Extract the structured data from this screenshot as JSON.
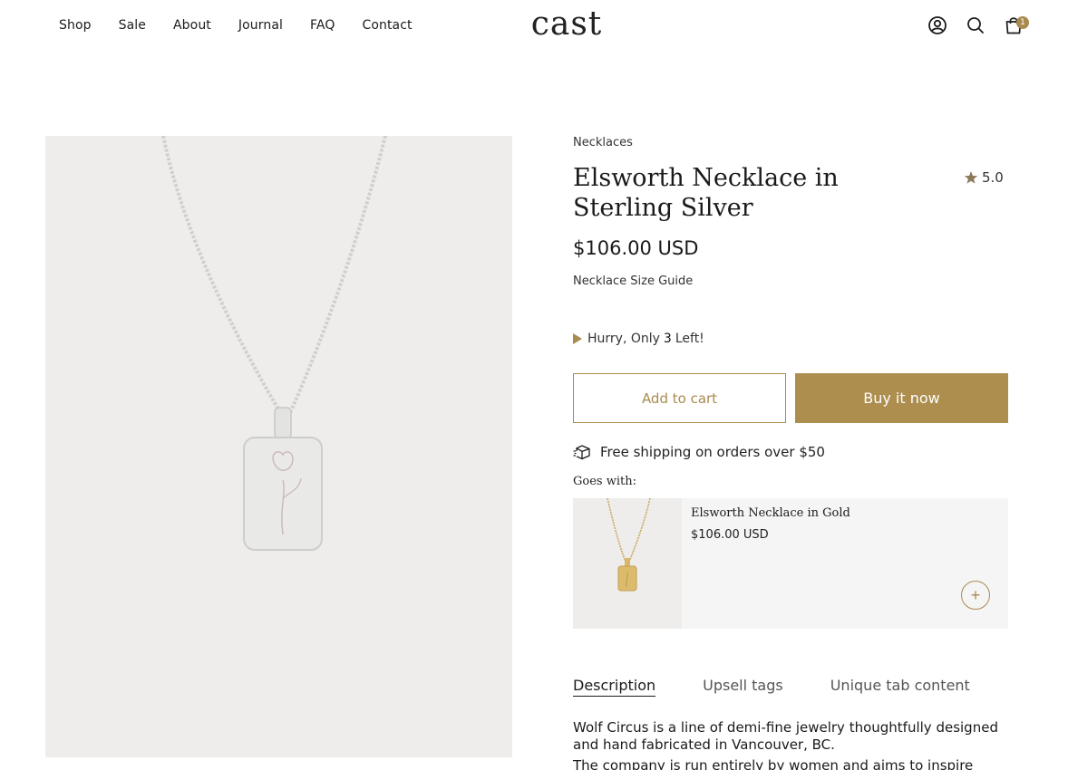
{
  "header": {
    "nav": [
      "Shop",
      "Sale",
      "About",
      "Journal",
      "FAQ",
      "Contact"
    ],
    "logo": "cast",
    "cart_count": "1",
    "icons": [
      "account-icon",
      "search-icon",
      "bag-icon"
    ]
  },
  "product": {
    "category": "Necklaces",
    "title": "Elsworth Necklace in Sterling Silver",
    "rating": "5.0",
    "price": "$106.00 USD",
    "size_guide": "Necklace Size Guide",
    "stock": {
      "prefix": "Hurry, Only",
      "count": "3",
      "suffix": "Left!"
    },
    "add_to_cart": "Add to cart",
    "buy_now": "Buy it now",
    "shipping": "Free shipping on orders over $50",
    "goes_with_label": "Goes with:",
    "upsell": {
      "name": "Elsworth Necklace in Gold",
      "price": "$106.00 USD"
    },
    "tabs": [
      "Description",
      "Upsell tags",
      "Unique tab content"
    ],
    "description": [
      "Wolf Circus is a line of demi-fine jewelry thoughtfully designed and hand fabricated in Vancouver, BC.",
      "The company is run entirely by women and aims to inspire"
    ]
  },
  "colors": {
    "accent": "#ad8e4f",
    "image_bg": "#eeedeb",
    "upsell_bg": "#f5f5f5"
  }
}
